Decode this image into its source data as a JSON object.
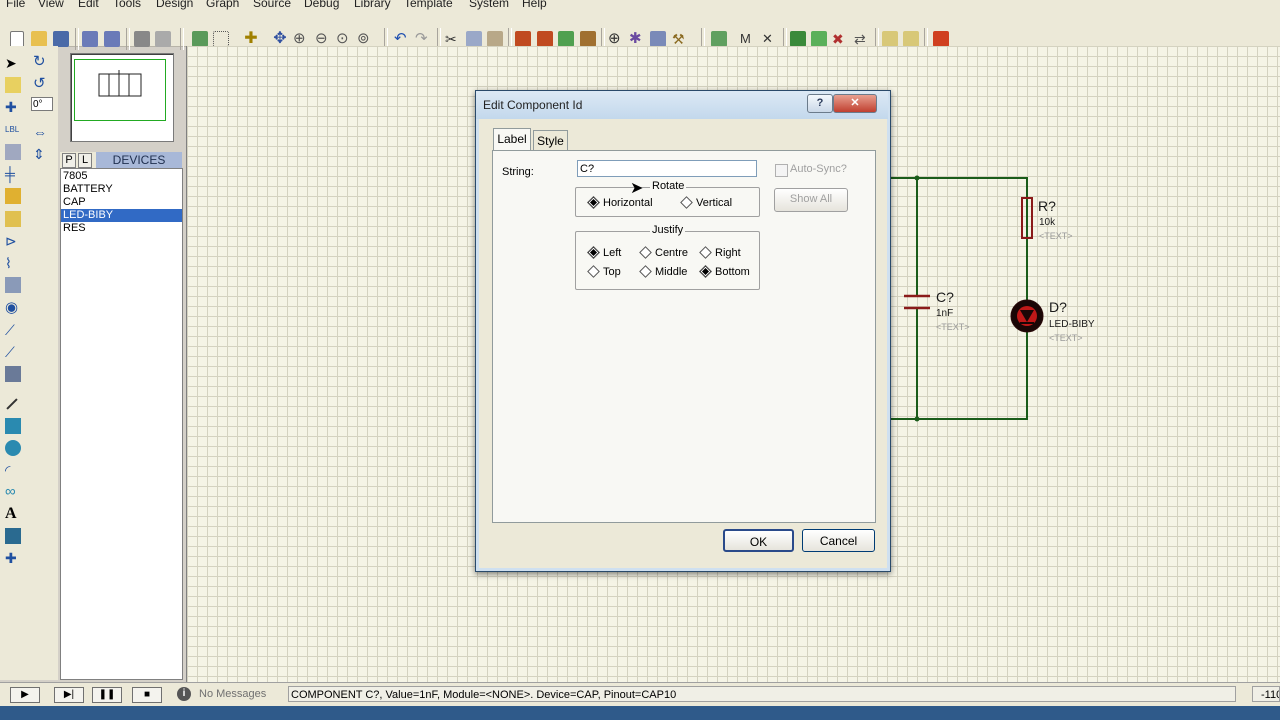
{
  "menubar": {
    "items": [
      "File",
      "View",
      "Edit",
      "Tools",
      "Design",
      "Graph",
      "Source",
      "Debug",
      "Library",
      "Template",
      "System",
      "Help"
    ]
  },
  "left_panel": {
    "zoom_field": "0°",
    "tab_p": "P",
    "tab_l": "L",
    "devices_label": "DEVICES",
    "devices": [
      "7805",
      "BATTERY",
      "CAP",
      "LED-BIBY",
      "RES"
    ],
    "selected_device": "LED-BIBY"
  },
  "schematic": {
    "resistor": {
      "ref": "R?",
      "value": "10k",
      "text": "<TEXT>"
    },
    "capacitor": {
      "ref": "C?",
      "value": "1nF",
      "text": "<TEXT>"
    },
    "led": {
      "ref": "D?",
      "value": "LED-BIBY",
      "text": "<TEXT>"
    },
    "wire_color": "#1a5c1a"
  },
  "dialog": {
    "title": "Edit Component Id",
    "help_button": "?",
    "close_button": "✕",
    "tabs": [
      "Label",
      "Style"
    ],
    "active_tab": "Label",
    "string_label": "String:",
    "string_value": "C?",
    "auto_sync_label": "Auto-Sync?",
    "show_all_label": "Show All",
    "rotate_label": "Rotate",
    "rotate_options": [
      "Horizontal",
      "Vertical"
    ],
    "rotate_selected": "Horizontal",
    "justify_label": "Justify",
    "justify_options": [
      "Left",
      "Centre",
      "Right",
      "Top",
      "Middle",
      "Bottom"
    ],
    "justify_selected": [
      "Left",
      "Bottom"
    ],
    "ok_label": "OK",
    "cancel_label": "Cancel"
  },
  "statusbar": {
    "messages": "No Messages",
    "status": "COMPONENT C?, Value=1nF, Module=<NONE>. Device=CAP, Pinout=CAP10",
    "coordinate": "-110"
  }
}
